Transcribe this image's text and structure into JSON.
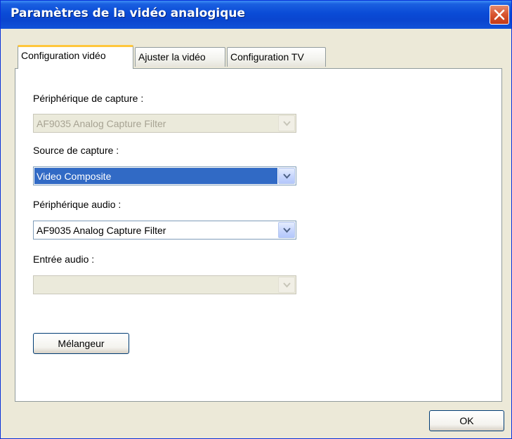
{
  "window": {
    "title": "Paramètres de la vidéo analogique"
  },
  "tabs": [
    {
      "label": "Configuration vidéo",
      "active": true
    },
    {
      "label": "Ajuster la vidéo",
      "active": false
    },
    {
      "label": "Configuration TV",
      "active": false
    }
  ],
  "form": {
    "capture_device": {
      "label": "Périphérique de capture :",
      "value": "AF9035 Analog Capture Filter",
      "enabled": false
    },
    "capture_source": {
      "label": "Source de capture :",
      "value": "Video Composite",
      "enabled": true
    },
    "audio_device": {
      "label": "Périphérique audio :",
      "value": "AF9035 Analog Capture Filter",
      "enabled": true
    },
    "audio_input": {
      "label": "Entrée audio :",
      "value": "",
      "enabled": false
    },
    "mixer_button": "Mélangeur"
  },
  "footer": {
    "ok_button": "OK"
  },
  "colors": {
    "titlebar": "#0a4bd6",
    "selection": "#316ac5",
    "active_tab_accent": "#ffc73c",
    "close_button": "#d8542f"
  }
}
